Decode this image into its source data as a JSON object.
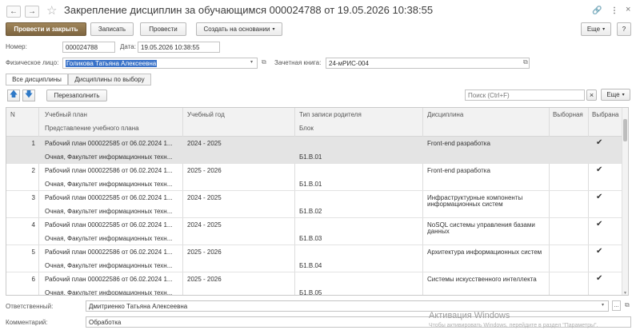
{
  "window": {
    "title": "Закрепление дисциплин за обучающимся 000024788 от 19.05.2026 10:38:55"
  },
  "toolbar": {
    "post_close": "Провести и закрыть",
    "save": "Записать",
    "post": "Провести",
    "create_based": "Создать на основании",
    "more": "Еще",
    "help": "?"
  },
  "form": {
    "number_label": "Номер:",
    "number_value": "000024788",
    "date_label": "Дата:",
    "date_value": "19.05.2026 10:38:55",
    "person_label": "Физическое лицо:",
    "person_value": "Голикова Татьяна Алексеевна",
    "gradebook_label": "Зачетная книга:",
    "gradebook_value": "24-мРИС-004"
  },
  "tabs": [
    {
      "label": "Все дисциплины"
    },
    {
      "label": "Дисциплины по выбору"
    }
  ],
  "table_toolbar": {
    "refill": "Перезаполнить",
    "search_placeholder": "Поиск (Ctrl+F)",
    "clear": "×",
    "more": "Еще"
  },
  "columns": {
    "n": "N",
    "plan": "Учебный план",
    "plan_sub": "Представление учебного плана",
    "year": "Учебный год",
    "record_type": "Тип записи родителя",
    "block": "Блок",
    "discipline": "Дисциплина",
    "elective": "Выборная",
    "selected": "Выбрана"
  },
  "rows": [
    {
      "n": "1",
      "plan": "Рабочий план 000022585 от 06.02.2024 1...",
      "plan_sub": "Очная, Факультет информационных техн...",
      "year": "2024 - 2025",
      "block": "Б1.В.01",
      "discipline": "Front-end разработка",
      "discipline2": "",
      "selected": "✔"
    },
    {
      "n": "2",
      "plan": "Рабочий план 000022586 от 06.02.2024 1...",
      "plan_sub": "Очная, Факультет информационных техн...",
      "year": "2025 - 2026",
      "block": "Б1.В.01",
      "discipline": "Front-end разработка",
      "discipline2": "",
      "selected": "✔"
    },
    {
      "n": "3",
      "plan": "Рабочий план 000022585 от 06.02.2024 1...",
      "plan_sub": "Очная, Факультет информационных техн...",
      "year": "2024 - 2025",
      "block": "Б1.В.02",
      "discipline": "Инфраструктурные компоненты",
      "discipline2": "информационных систем",
      "selected": "✔"
    },
    {
      "n": "4",
      "plan": "Рабочий план 000022585 от 06.02.2024 1...",
      "plan_sub": "Очная, Факультет информационных техн...",
      "year": "2024 - 2025",
      "block": "Б1.В.03",
      "discipline": "NoSQL системы управления базами",
      "discipline2": "данных",
      "selected": "✔"
    },
    {
      "n": "5",
      "plan": "Рабочий план 000022586 от 06.02.2024 1...",
      "plan_sub": "Очная, Факультет информационных техн...",
      "year": "2025 - 2026",
      "block": "Б1.В.04",
      "discipline": "Архитектура информационных систем",
      "discipline2": "",
      "selected": "✔"
    },
    {
      "n": "6",
      "plan": "Рабочий план 000022586 от 06.02.2024 1...",
      "plan_sub": "Очная, Факультет информационных техн...",
      "year": "2025 - 2026",
      "block": "Б1.В.05",
      "discipline": "Системы искусственного интеллекта",
      "discipline2": "",
      "selected": "✔"
    }
  ],
  "footer": {
    "responsible_label": "Ответственный:",
    "responsible_value": "Дмитриенко Татьяна Алексеевна",
    "comment_label": "Комментарий:",
    "comment_value": "Обработка"
  },
  "watermark": {
    "line1": "Активация Windows",
    "line2": "Чтобы активировать Windows, перейдите в раздел \"Параметры\"."
  }
}
